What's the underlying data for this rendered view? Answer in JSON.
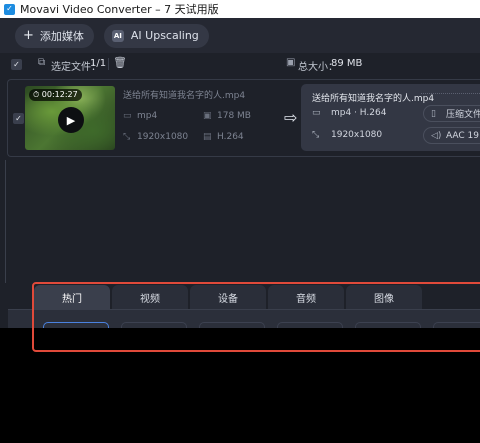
{
  "window": {
    "title": "Movavi Video Converter – 7 天试用版",
    "icon_glyph": "✓"
  },
  "toolbar": {
    "add_media_icon": "+",
    "add_media_label": "添加媒体",
    "ai_badge": "AI",
    "ai_upscaling_label": "AI Upscaling"
  },
  "selection": {
    "checkbox": "✓",
    "files_icon": "⧉",
    "selected_label": "选定文件：",
    "selected_count": "1/1",
    "trash_icon": "🗑",
    "size_icon": "▣",
    "total_size_label": "总大小：",
    "total_size_value": "89 MB"
  },
  "file": {
    "checkbox": "✓",
    "duration": "⏱ 00:12:27",
    "play_icon": "▶",
    "source": {
      "name": "送给所有知道我名字的人.mp4",
      "format_icon": "▭",
      "format": "mp4",
      "size_icon": "▣",
      "size": "178 MB",
      "resolution_icon": "⤡",
      "resolution": "1920x1080",
      "codec_icon": "▤",
      "codec": "H.264"
    },
    "arrow_icon": "⇨",
    "output": {
      "name": "送给所有知道我名字的人.mp4",
      "format_icon": "▭",
      "format": "mp4 · H.264",
      "resolution_icon": "⤡",
      "resolution": "1920x1080",
      "compress_icon": "▯",
      "compress_label": "压缩文件",
      "audio_icon": "◁)",
      "audio_label": "AAC 19"
    }
  },
  "tabs": [
    "热门",
    "视频",
    "设备",
    "音频",
    "图像"
  ],
  "colors": {
    "highlight_frame": "#e04a3a",
    "accent": "#4a82e0",
    "background": "#1e2129"
  }
}
